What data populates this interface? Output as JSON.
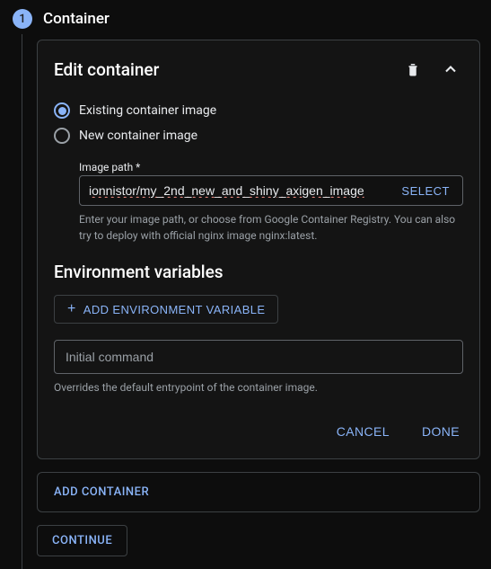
{
  "step": {
    "number": "1",
    "title": "Container"
  },
  "card": {
    "title": "Edit container",
    "radios": {
      "existing": "Existing container image",
      "new": "New container image"
    },
    "imagePath": {
      "label": "Image path *",
      "value": "ionnistor/my_2nd_new_and_shiny_axigen_image",
      "selectLabel": "SELECT",
      "helper": "Enter your image path, or choose from Google Container Registry. You can also try to deploy with official nginx image nginx:latest."
    },
    "envSection": {
      "title": "Environment variables",
      "addLabel": "ADD ENVIRONMENT VARIABLE"
    },
    "command": {
      "placeholder": "Initial command",
      "helper": "Overrides the default entrypoint of the container image."
    },
    "actions": {
      "cancel": "CANCEL",
      "done": "DONE"
    }
  },
  "addContainer": "ADD CONTAINER",
  "continue": "CONTINUE"
}
